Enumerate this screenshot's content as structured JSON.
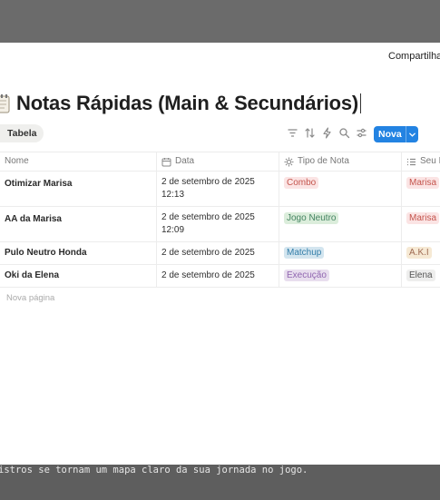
{
  "header": {
    "share_label": "Compartilhar"
  },
  "page": {
    "title": "Notas Rápidas (Main & Secundários)"
  },
  "view": {
    "tab_label": "Tabela"
  },
  "toolbar": {
    "icons": [
      "filter-icon",
      "sort-icon",
      "automation-icon",
      "search-icon",
      "settings-icon"
    ],
    "new_label": "Nova"
  },
  "table": {
    "columns": [
      {
        "label": "Nome",
        "icon": "none"
      },
      {
        "label": "Data",
        "icon": "calendar-icon"
      },
      {
        "label": "Tipo de Nota",
        "icon": "select-icon"
      },
      {
        "label": "Seu P",
        "icon": "list-icon"
      }
    ],
    "rows": [
      {
        "name": "Otimizar Marisa",
        "date": "2 de setembro de 2025",
        "time": "12:13",
        "type": {
          "label": "Combo",
          "bg": "#fbe4e4",
          "fg": "#c4554d"
        },
        "char": {
          "label": "Marisa",
          "bg": "#fbe4e4",
          "fg": "#c4554d"
        }
      },
      {
        "name": "AA da Marisa",
        "date": "2 de setembro de 2025",
        "time": "12:09",
        "type": {
          "label": "Jogo Neutro",
          "bg": "#dbeddb",
          "fg": "#448361"
        },
        "char": {
          "label": "Marisa",
          "bg": "#fbe4e4",
          "fg": "#c4554d"
        }
      },
      {
        "name": "Pulo Neutro Honda",
        "date": "2 de setembro de 2025",
        "time": "",
        "type": {
          "label": "Matchup",
          "bg": "#d3e5ef",
          "fg": "#337ea9"
        },
        "char": {
          "label": "A.K.I",
          "bg": "#f6e9d4",
          "fg": "#9f6b53"
        }
      },
      {
        "name": "Oki da Elena",
        "date": "2 de setembro de 2025",
        "time": "",
        "type": {
          "label": "Execução",
          "bg": "#e8deee",
          "fg": "#9065b0"
        },
        "char": {
          "label": "Elena",
          "bg": "#eeeeed",
          "fg": "#555555"
        }
      }
    ],
    "new_page_label": "Nova página"
  },
  "footer": {
    "text": "istros se tornam um mapa claro da sua jornada no jogo."
  }
}
